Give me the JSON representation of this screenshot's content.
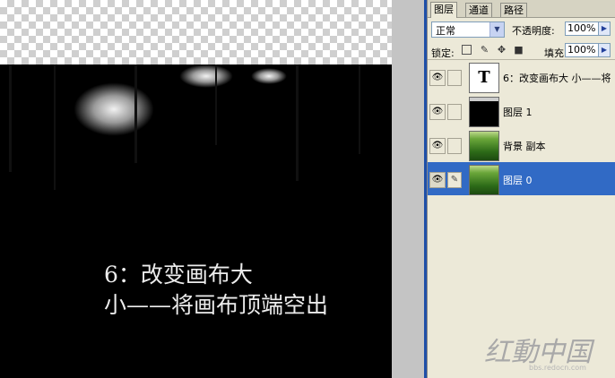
{
  "canvas": {
    "caption_line1": "6：改变画布大",
    "caption_line2": "小——将画布顶端空出"
  },
  "layers_panel": {
    "tabs": [
      "图层",
      "通道",
      "路径"
    ],
    "blend_mode": "正常",
    "opacity_label": "不透明度:",
    "opacity_value": "100%",
    "lock_label": "锁定:",
    "fill_label": "填充:",
    "fill_value": "100%",
    "layers": [
      {
        "name": "6：改变画布大 小——将",
        "thumb": "T",
        "selected": false
      },
      {
        "name": "图层 1",
        "selected": false
      },
      {
        "name": "背景 副本",
        "selected": false
      },
      {
        "name": "图层 0",
        "selected": true
      }
    ]
  },
  "watermark": {
    "logo_text": "红動中国",
    "url": "bbs.redocn.com"
  },
  "colors": {
    "selection": "#316ac5",
    "panel_bg": "#ece9d8"
  }
}
